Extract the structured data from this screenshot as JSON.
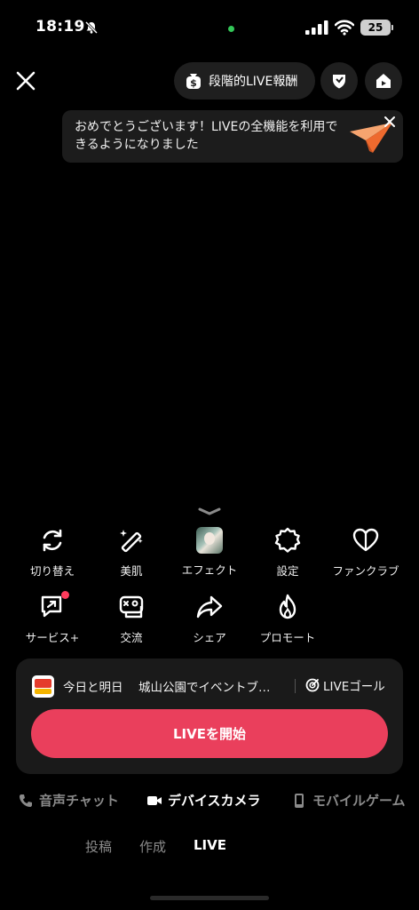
{
  "status_bar": {
    "time": "18:19",
    "battery": "25"
  },
  "top_bar": {
    "reward_label": "段階的LIVE報酬"
  },
  "toast": {
    "message": "おめでとうございます！LIVEの全機能を利用できるようになりました"
  },
  "tools": [
    {
      "label": "切り替え",
      "icon": "flip-camera-icon"
    },
    {
      "label": "美肌",
      "icon": "magic-wand-icon"
    },
    {
      "label": "エフェクト",
      "icon": "effect-thumbnail"
    },
    {
      "label": "設定",
      "icon": "gear-icon"
    },
    {
      "label": "ファンクラブ",
      "icon": "heart-icon"
    },
    {
      "label": "サービス+",
      "icon": "service-icon"
    },
    {
      "label": "交流",
      "icon": "game-controller-icon"
    },
    {
      "label": "シェア",
      "icon": "share-arrow-icon"
    },
    {
      "label": "プロモート",
      "icon": "flame-icon"
    }
  ],
  "event": {
    "date": "今日と明日",
    "title": "城山公園でイベントブ…",
    "goal_label": "LIVEゴール"
  },
  "go_live_label": "LIVEを開始",
  "modes": [
    {
      "label": "音声チャット",
      "icon": "phone-icon",
      "active": false
    },
    {
      "label": "デバイスカメラ",
      "icon": "camera-icon",
      "active": true
    },
    {
      "label": "モバイルゲーム",
      "icon": "mobile-icon",
      "active": false
    }
  ],
  "tabs": [
    {
      "label": "投稿",
      "active": false
    },
    {
      "label": "作成",
      "active": false
    },
    {
      "label": "LIVE",
      "active": true
    }
  ],
  "colors": {
    "accent": "#ea3f5c",
    "panel": "#1a1a1a",
    "status_dot": "#33c758"
  }
}
